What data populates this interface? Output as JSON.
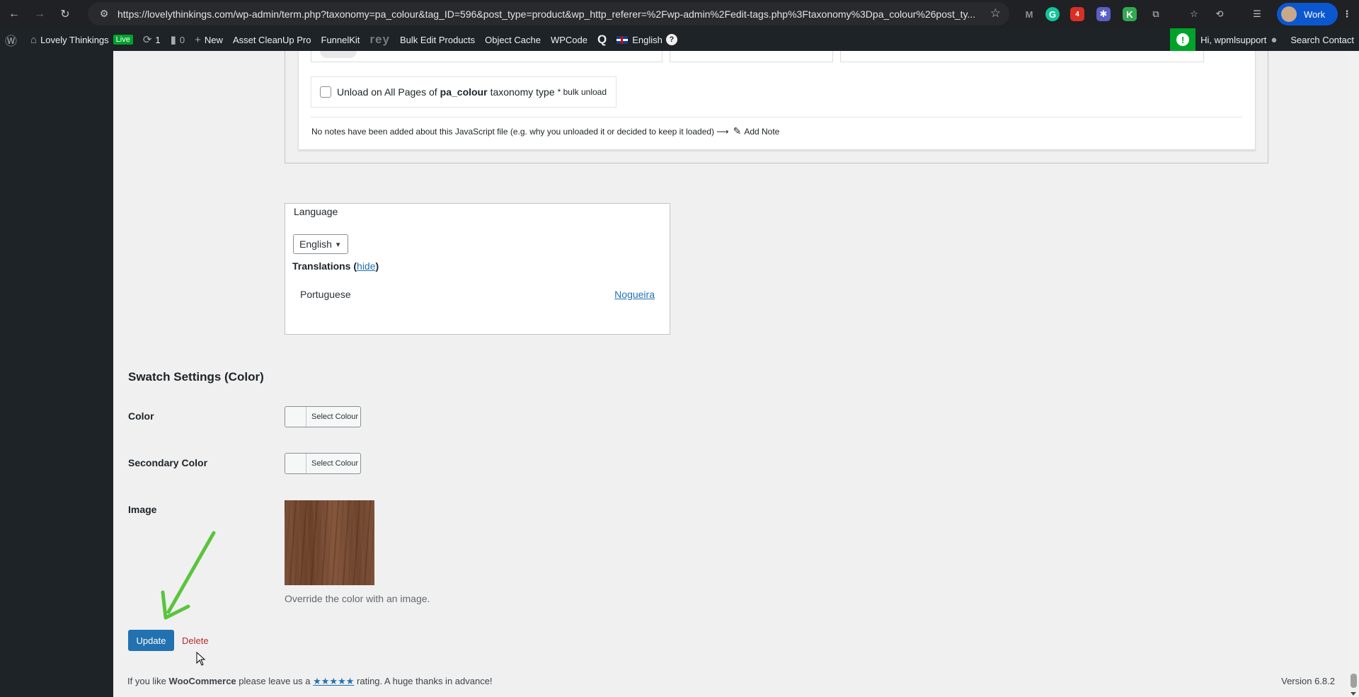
{
  "browser": {
    "url": "https://lovelythinkings.com/wp-admin/term.php?taxonomy=pa_colour&tag_ID=596&post_type=product&wp_http_referer=%2Fwp-admin%2Fedit-tags.php%3Ftaxonomy%3Dpa_colour%26post_ty...",
    "profile_label": "Work",
    "extension_badge": "4"
  },
  "adminbar": {
    "site_name": "Lovely Thinkings",
    "live_badge": "Live",
    "updates_count": "1",
    "comments_count": "0",
    "new_label": "New",
    "asset_cleanup": "Asset CleanUp Pro",
    "funnelkit": "FunnelKit",
    "rey": "rey",
    "bulk_edit": "Bulk Edit Products",
    "object_cache": "Object Cache",
    "wpcode": "WPCode",
    "language": "English",
    "greeting": "Hi, wpmlsupport",
    "search_contact": "Search Contact"
  },
  "asset_cleanup": {
    "bulk_unload_prefix": "Unload on All Pages of",
    "bulk_unload_taxonomy": "pa_colour",
    "bulk_unload_suffix": "taxonomy type",
    "bulk_unload_note": "* bulk unload",
    "notes_text": "No notes have been added about this JavaScript file (e.g. why you unloaded it or decided to keep it loaded) ⟶",
    "add_note": "Add Note"
  },
  "language_box": {
    "title": "Language",
    "selected_language": "English",
    "translations_label": "Translations",
    "hide_link": "hide",
    "translation_language": "Portuguese",
    "translation_term": "Nogueira"
  },
  "swatch": {
    "title": "Swatch Settings (Color)",
    "color_label": "Color",
    "color_button": "Select Colour",
    "secondary_label": "Secondary Color",
    "secondary_button": "Select Colour",
    "image_label": "Image",
    "image_help": "Override the color with an image."
  },
  "actions": {
    "update": "Update",
    "delete": "Delete"
  },
  "footer": {
    "prefix": "If you like",
    "brand": "WooCommerce",
    "middle": "please leave us a",
    "stars": "★★★★★",
    "suffix": "rating. A huge thanks in advance!",
    "version": "Version 6.8.2"
  },
  "colors": {
    "wp_blue": "#2271b1",
    "admin_dark": "#1d2327",
    "delete_red": "#b32d2e",
    "annotation_arrow": "#5ac43d"
  }
}
